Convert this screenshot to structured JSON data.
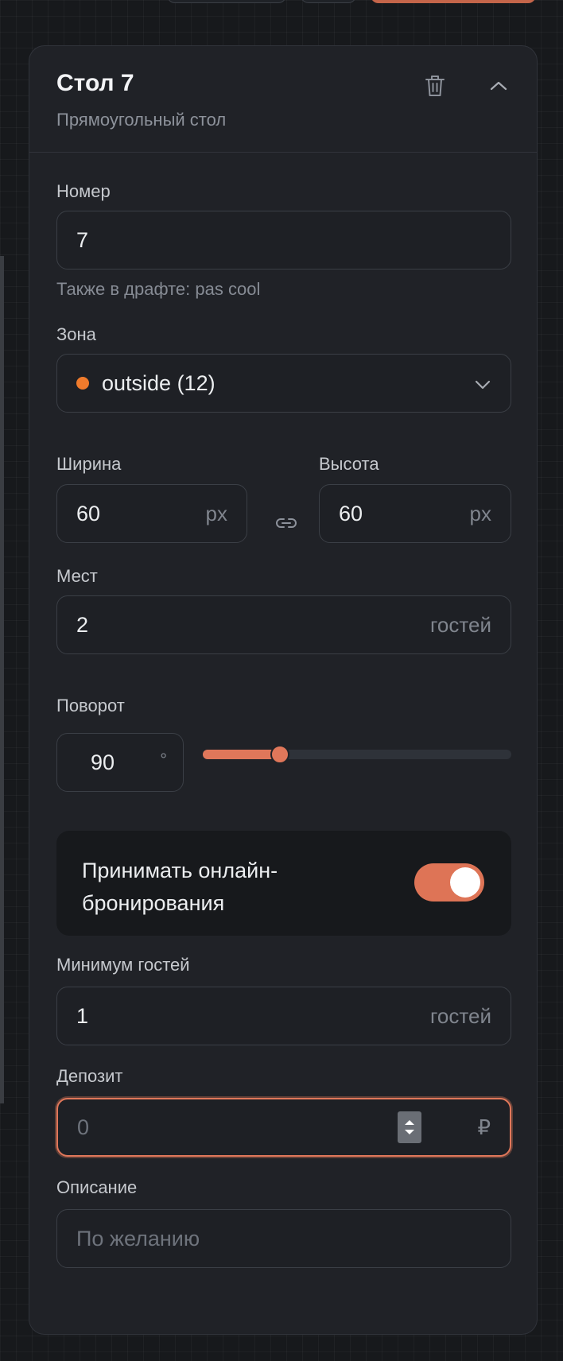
{
  "panel": {
    "title": "Стол 7",
    "subtitle": "Прямоугольный стол"
  },
  "number": {
    "label": "Номер",
    "value": "7",
    "hint": "Также в драфте: pas cool"
  },
  "zone": {
    "label": "Зона",
    "value": "outside (12)",
    "color": "#f07b2c"
  },
  "width": {
    "label": "Ширина",
    "value": "60",
    "unit": "px"
  },
  "height": {
    "label": "Высота",
    "value": "60",
    "unit": "px"
  },
  "seats": {
    "label": "Мест",
    "value": "2",
    "unit": "гостей"
  },
  "rotation": {
    "label": "Поворот",
    "value": "90",
    "unit": "°",
    "slider_fraction": 0.25
  },
  "online_booking": {
    "label": "Принимать онлайн-бронирования",
    "enabled": true
  },
  "min_guests": {
    "label": "Минимум гостей",
    "value": "1",
    "unit": "гостей"
  },
  "deposit": {
    "label": "Депозит",
    "placeholder": "0",
    "unit": "₽"
  },
  "description": {
    "label": "Описание",
    "placeholder": "По желанию"
  },
  "colors": {
    "accent": "#e0775a",
    "zone_dot": "#f07b2c",
    "panel_bg": "#202227"
  }
}
